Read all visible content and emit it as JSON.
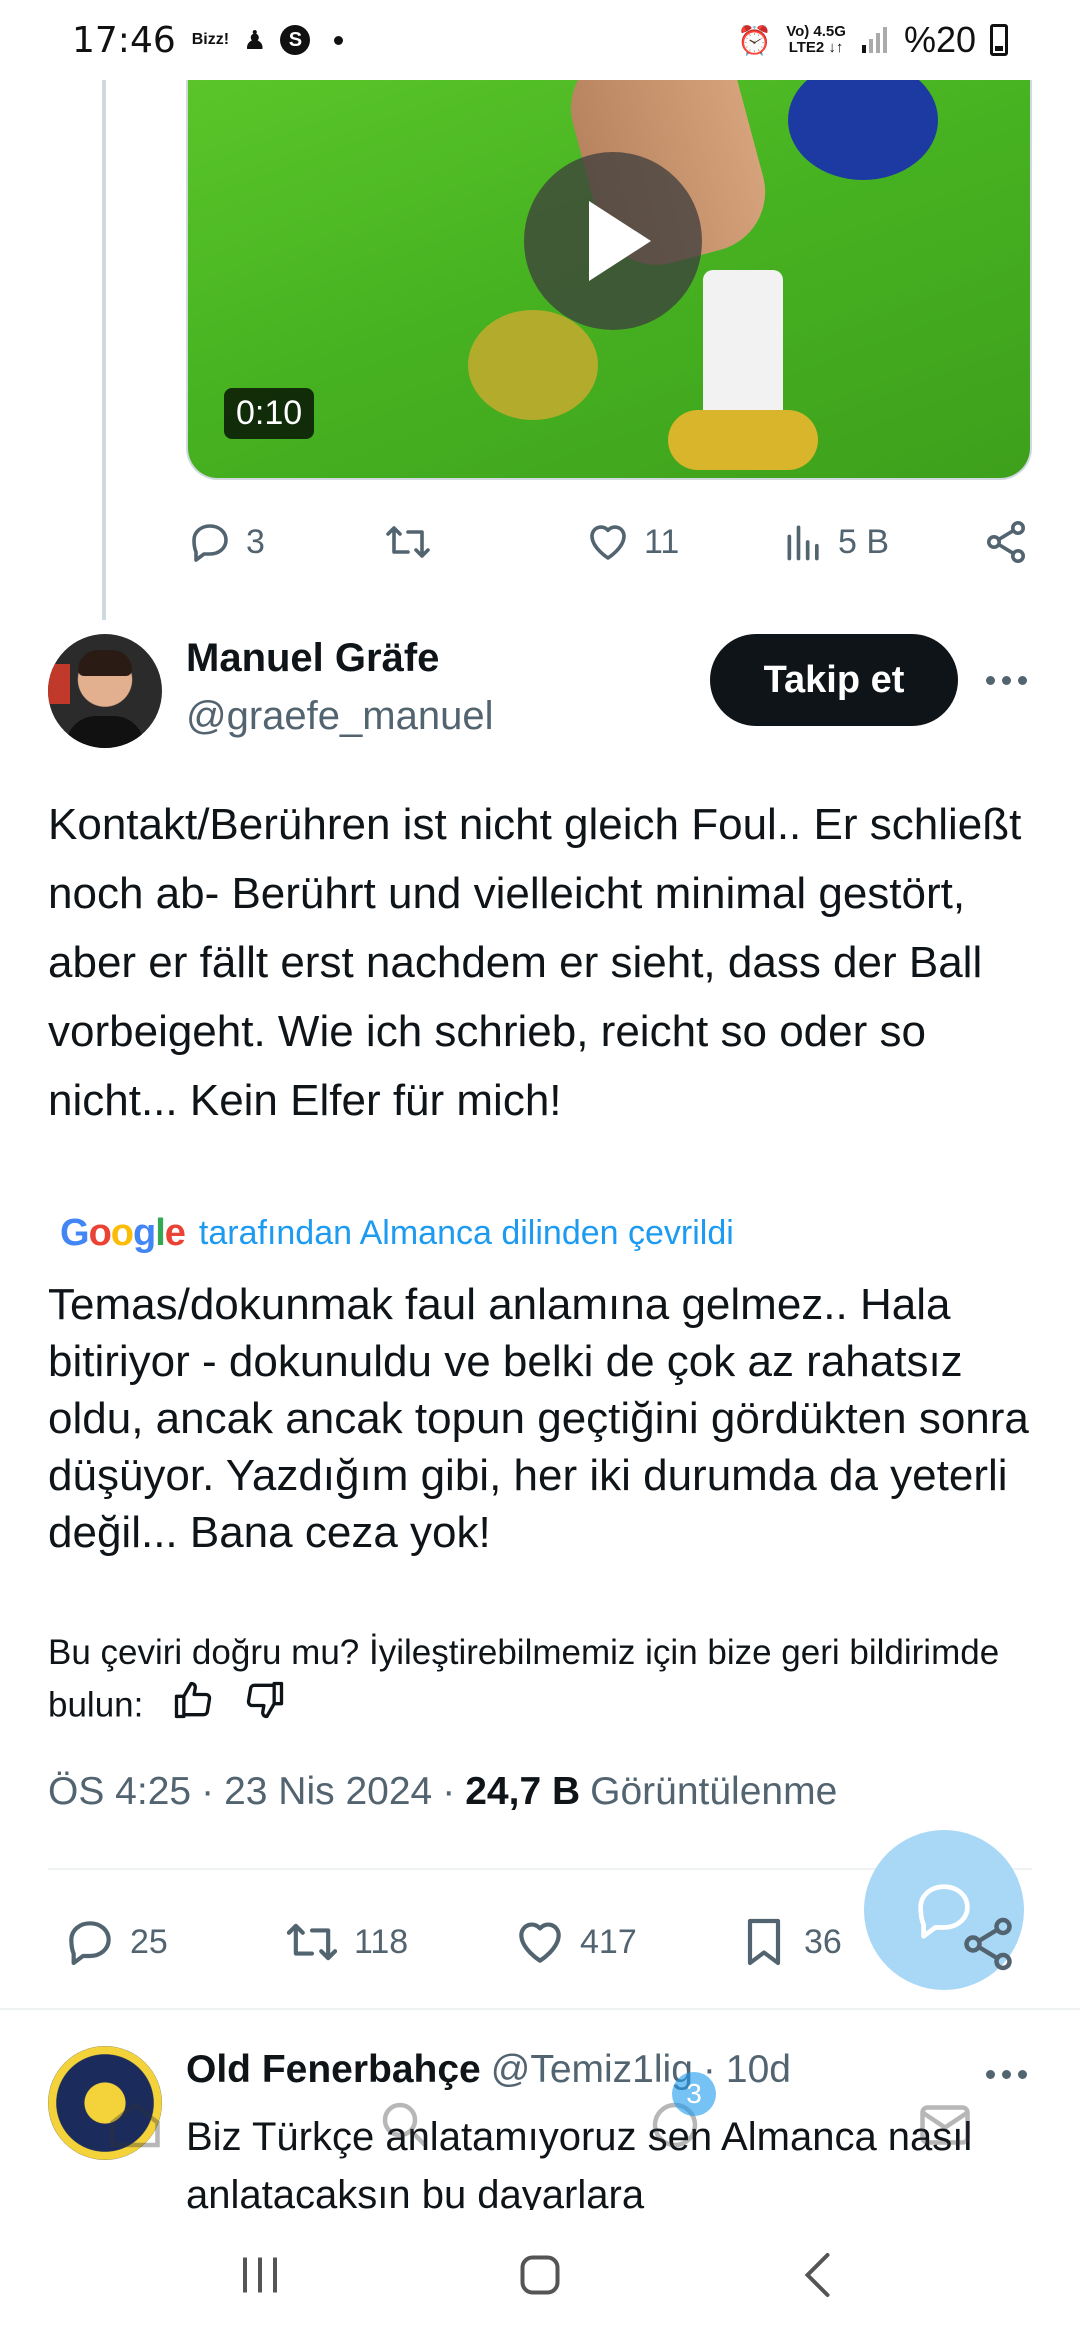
{
  "status_bar": {
    "time": "17:46",
    "carrier_mini": "Bizz!",
    "network_top": "Vo) 4.5G",
    "network_bottom": "LTE2 ↓↑",
    "battery": "%20"
  },
  "video": {
    "duration": "0:10"
  },
  "quoted_actions": {
    "replies": "3",
    "likes": "11",
    "views": "5 B"
  },
  "tweet": {
    "author_name": "Manuel Gräfe",
    "author_handle": "@graefe_manuel",
    "follow_label": "Takip et",
    "original_text": "Kontakt/Berühren ist nicht gleich Foul.. Er schließt noch ab-  Berührt und vielleicht minimal gestört, aber er fällt erst nachdem er sieht, dass der Ball vorbeigeht. Wie ich schrieb, reicht so oder so nicht... Kein Elfer für mich!",
    "translation_credit": "tarafından Almanca dilinden çevrildi",
    "translated_text": "Temas/dokunmak faul anlamına gelmez.. Hala bitiriyor - dokunuldu ve belki de çok az rahatsız oldu, ancak ancak topun geçtiğini gördükten sonra düşüyor. Yazdığım gibi, her iki durumda da yeterli değil... Bana ceza yok!",
    "feedback_prompt": "Bu çeviri doğru mu? İyileştirebilmemiz için bize geri bildirimde bulun:",
    "time": "ÖS 4:25",
    "date": "23 Nis 2024",
    "views_count": "24,7 B",
    "views_label": "Görüntülenme",
    "replies": "25",
    "retweets": "118",
    "likes": "417",
    "bookmarks": "36"
  },
  "reply": {
    "author_name": "Old Fenerbahçe",
    "author_handle": "@Temiz1lig",
    "age": "10d",
    "text": "Biz Türkçe anlatamıyoruz sen Almanca nasıl anlatacaksın bu dayarlara"
  },
  "tab_bar": {
    "notification_count": "3"
  },
  "colors": {
    "accent": "#1d9bf0",
    "muted": "#536471",
    "text": "#0f1419",
    "fab": "#a9d8f7"
  }
}
